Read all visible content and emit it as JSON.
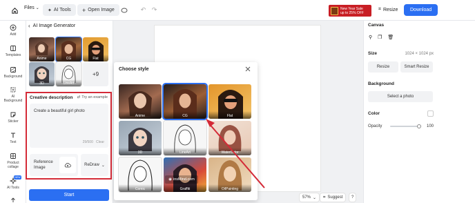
{
  "topbar": {
    "files_label": "Files",
    "ai_tools_label": "AI Tools",
    "open_image_label": "Open Image",
    "promo_line1": "New Year Sale",
    "promo_line2": "up to 25% OFF",
    "resize_label": "Resize",
    "download_label": "Download"
  },
  "rail": {
    "items": [
      {
        "label": "Add",
        "icon": "plus-circle-icon"
      },
      {
        "label": "Templates",
        "icon": "templates-icon"
      },
      {
        "label": "Background",
        "icon": "background-icon"
      },
      {
        "label": "AI Background",
        "icon": "ai-background-icon"
      },
      {
        "label": "Sticker",
        "icon": "sticker-icon"
      },
      {
        "label": "Text",
        "icon": "text-icon"
      },
      {
        "label": "Product collage",
        "icon": "collage-icon"
      },
      {
        "label": "AI Tools",
        "icon": "ai-tools-icon",
        "badge": "NEW"
      },
      {
        "label": "Upload",
        "icon": "upload-icon"
      }
    ]
  },
  "ai_panel": {
    "title": "AI Image Generator",
    "styles": [
      "Anime",
      "CG",
      "Flat",
      "3D",
      "LineArt"
    ],
    "more_count": "+9",
    "creative_title": "Creative description",
    "try_example": "Try an example",
    "prompt_value": "Create a beautiful girl photo",
    "char_count": "29/500",
    "clear_label": "Clear",
    "reference_label_1": "Reference",
    "reference_label_2": "Image",
    "mode_label": "ReDraw",
    "start_label": "Start"
  },
  "modal": {
    "title": "Choose style",
    "styles": [
      "Anime",
      "CG",
      "Flat",
      "3D",
      "LineArt",
      "WaterColor",
      "Comic",
      "Graffiti",
      "OilPainting"
    ],
    "selected": "CG",
    "watermark": "insMind.com"
  },
  "canvas": {
    "zoom": "57%",
    "suggest_label": "Suggest",
    "help_label": "?"
  },
  "right_panel": {
    "canvas_title": "Canvas",
    "size_label": "Size",
    "size_value": "1024 × 1024 px",
    "resize_label": "Resize",
    "smart_resize_label": "Smart Resize",
    "background_label": "Background",
    "select_photo_label": "Select a photo",
    "color_label": "Color",
    "opacity_label": "Opacity",
    "opacity_value": "100"
  },
  "colors": {
    "accent": "#2b6ff2",
    "highlight_red": "#d42a37",
    "promo": "#c81e24"
  }
}
